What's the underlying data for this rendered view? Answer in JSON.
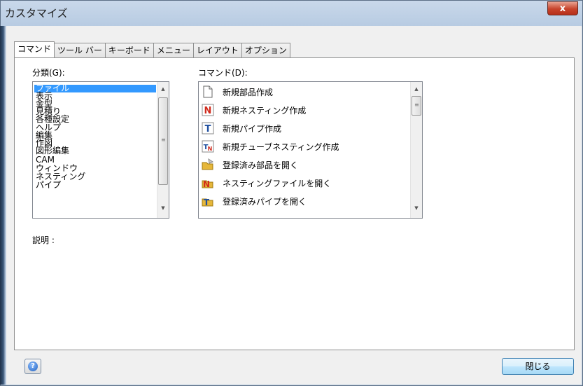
{
  "window": {
    "title": "カスタマイズ",
    "close_glyph": "x"
  },
  "tabs": [
    {
      "label": "コマンド",
      "active": true
    },
    {
      "label": "ツール バー",
      "active": false
    },
    {
      "label": "キーボード",
      "active": false
    },
    {
      "label": "メニュー",
      "active": false
    },
    {
      "label": "レイアウト",
      "active": false
    },
    {
      "label": "オプション",
      "active": false
    }
  ],
  "category": {
    "label": "分類(G):",
    "items": [
      "ファイル",
      "表示",
      "金型",
      "見積り",
      "各種設定",
      "ヘルプ",
      "編集",
      "作図",
      "図形編集",
      "CAM",
      "ウィンドウ",
      "ネスティング",
      "パイプ"
    ],
    "selected_index": 0
  },
  "commands": {
    "label": "コマンド(D):",
    "items": [
      {
        "label": "新規部品作成",
        "icon": "new-document-icon"
      },
      {
        "label": "新規ネスティング作成",
        "icon": "nesting-n-icon"
      },
      {
        "label": "新規パイプ作成",
        "icon": "pipe-t-icon"
      },
      {
        "label": "新規チューブネスティング作成",
        "icon": "tube-nesting-icon"
      },
      {
        "label": "登録済み部品を開く",
        "icon": "open-folder-icon"
      },
      {
        "label": "ネスティングファイルを開く",
        "icon": "open-nesting-icon"
      },
      {
        "label": "登録済みパイプを開く",
        "icon": "open-pipe-icon"
      }
    ]
  },
  "description": {
    "label": "説明 :"
  },
  "buttons": {
    "help_glyph": "?",
    "close_label": "閉じる"
  },
  "colors": {
    "selection": "#3399ff",
    "accent_red": "#d02a1c",
    "accent_blue": "#1f5fbf"
  }
}
